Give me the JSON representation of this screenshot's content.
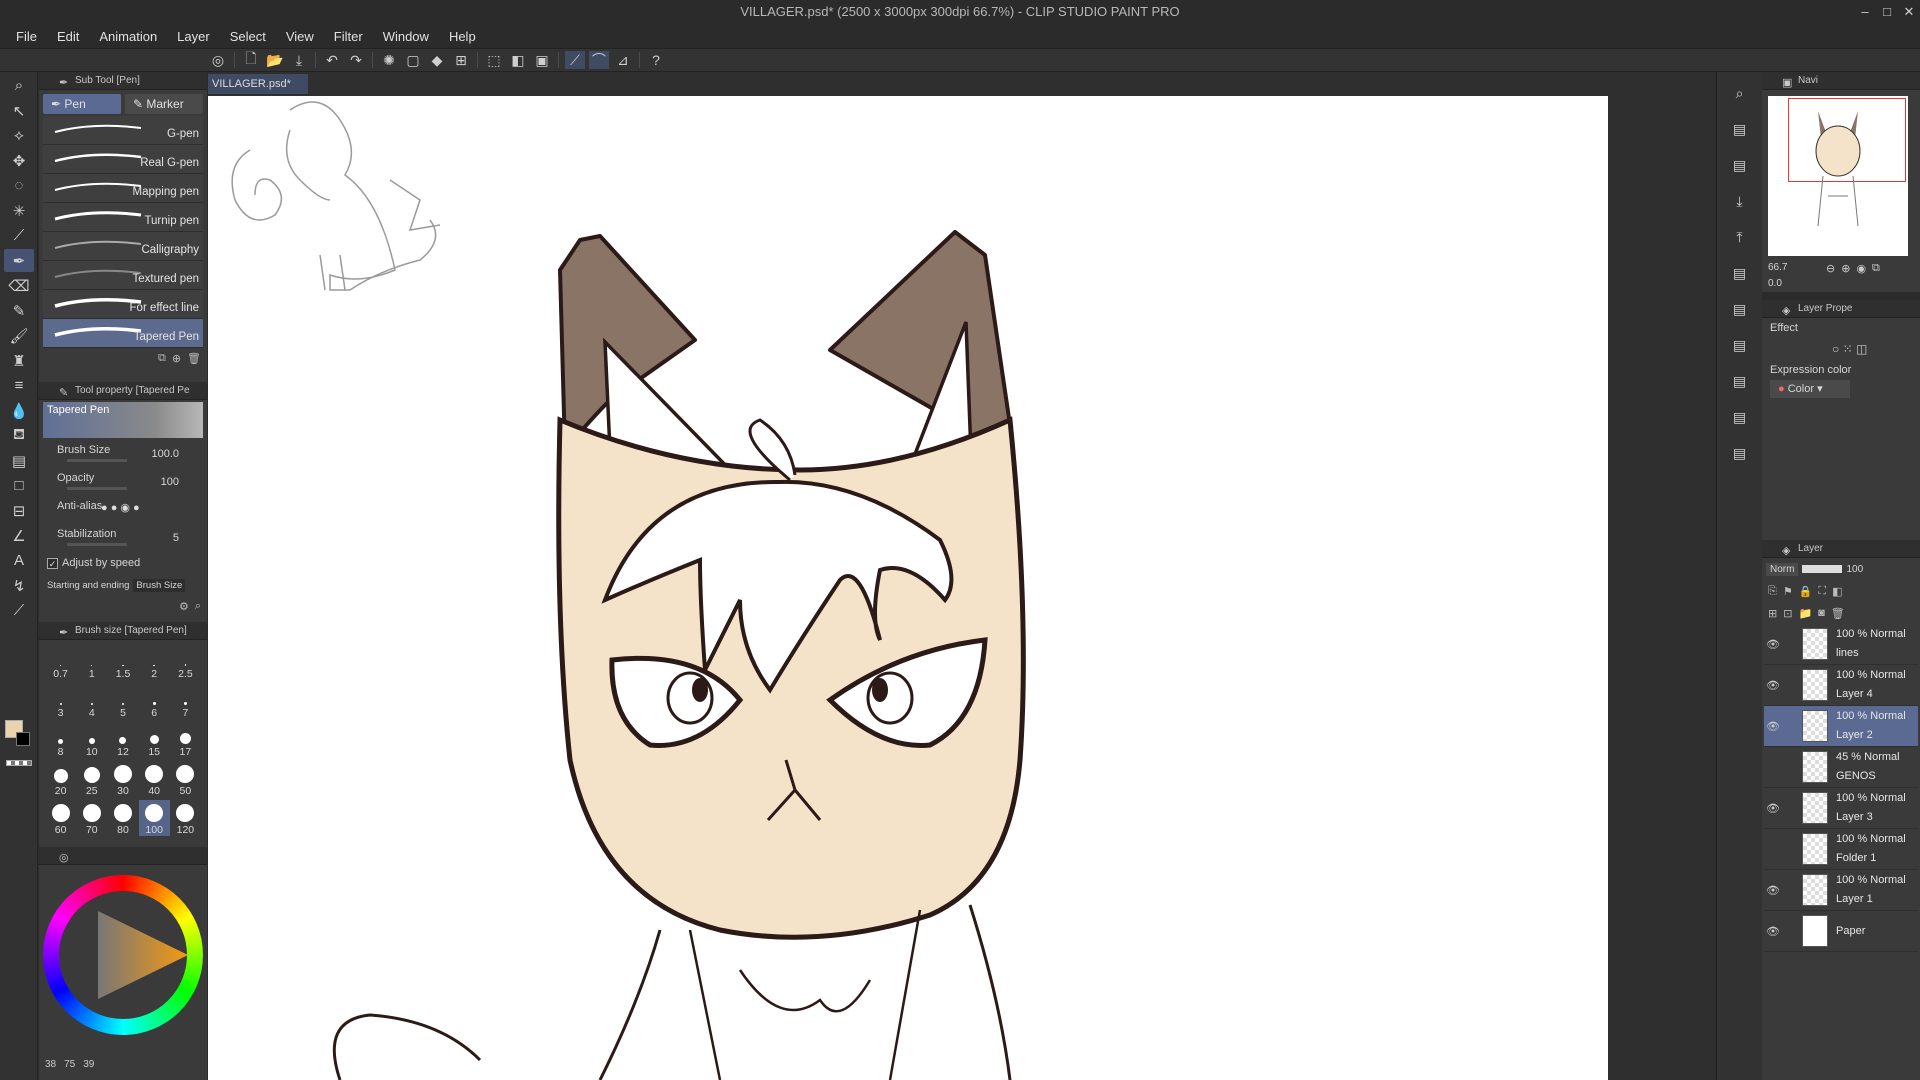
{
  "window": {
    "title": "VILLAGER.psd* (2500 x 3000px 300dpi 66.7%)  - CLIP STUDIO PAINT PRO"
  },
  "menu": [
    "File",
    "Edit",
    "Animation",
    "Layer",
    "Select",
    "View",
    "Filter",
    "Window",
    "Help"
  ],
  "doc_tab": {
    "label": "VILLAGER.psd*",
    "close": "×"
  },
  "subtool": {
    "title": "Sub Tool [Pen]",
    "tabs": [
      "Pen",
      "Marker"
    ],
    "brushes": [
      "G-pen",
      "Real G-pen",
      "Mapping pen",
      "Turnip pen",
      "Calligraphy",
      "Textured pen",
      "For effect line",
      "Tapered Pen"
    ]
  },
  "tool_property": {
    "title": "Tool property [Tapered Pe",
    "preview_name": "Tapered Pen",
    "brush_size_label": "Brush Size",
    "brush_size_value": "100.0",
    "opacity_label": "Opacity",
    "opacity_value": "100",
    "antialias_label": "Anti-alias",
    "stabilization_label": "Stabilization",
    "stabilization_value": "5",
    "adjust_speed_label": "Adjust by speed",
    "start_end_label": "Starting and ending",
    "start_end_value": "Brush Size"
  },
  "brush_size_panel": {
    "title": "Brush size [Tapered Pen]",
    "sizes": [
      "0.7",
      "1",
      "1.5",
      "2",
      "2.5",
      "3",
      "4",
      "5",
      "6",
      "7",
      "8",
      "10",
      "12",
      "15",
      "17",
      "20",
      "25",
      "30",
      "40",
      "50",
      "60",
      "70",
      "80",
      "100",
      "120"
    ],
    "selected": "100"
  },
  "color": {
    "main": "#ebd3b0",
    "sub": "#000000",
    "rgb_values": [
      "38",
      "75",
      "39"
    ]
  },
  "navigator": {
    "title": "Navi",
    "zoom": "66.7",
    "angle": "0.0"
  },
  "layer_property": {
    "title": "Layer Prope",
    "effect_label": "Effect",
    "expression_label": "Expression color",
    "expression_value": "Color"
  },
  "layer_panel": {
    "title": "Layer",
    "blend": "Norm",
    "opacity": "100",
    "layers": [
      {
        "mode": "100 % Normal",
        "name": "lines",
        "visible": true,
        "selected": false
      },
      {
        "mode": "100 % Normal",
        "name": "Layer 4",
        "visible": true,
        "selected": false
      },
      {
        "mode": "100 % Normal",
        "name": "Layer 2",
        "visible": true,
        "selected": true
      },
      {
        "mode": "45 % Normal",
        "name": "GENOS",
        "visible": false,
        "selected": false
      },
      {
        "mode": "100 % Normal",
        "name": "Layer 3",
        "visible": true,
        "selected": false
      },
      {
        "mode": "100 % Normal",
        "name": "Folder 1",
        "visible": false,
        "selected": false
      },
      {
        "mode": "100 % Normal",
        "name": "Layer 1",
        "visible": true,
        "selected": false
      },
      {
        "mode": "",
        "name": "Paper",
        "visible": true,
        "selected": false
      }
    ]
  },
  "icons": {
    "tools": [
      "zoom-icon",
      "move-icon",
      "select-icon",
      "lasso-icon",
      "magic-wand-icon",
      "eyedropper-icon",
      "pen-icon",
      "eraser-icon",
      "pencil-icon",
      "brush-icon",
      "airbrush-icon",
      "decoration-icon",
      "blend-icon",
      "fill-icon",
      "gradient-icon",
      "figure-icon",
      "frame-icon",
      "ruler-icon",
      "text-icon",
      "balloon-icon",
      "correct-line-icon"
    ]
  }
}
